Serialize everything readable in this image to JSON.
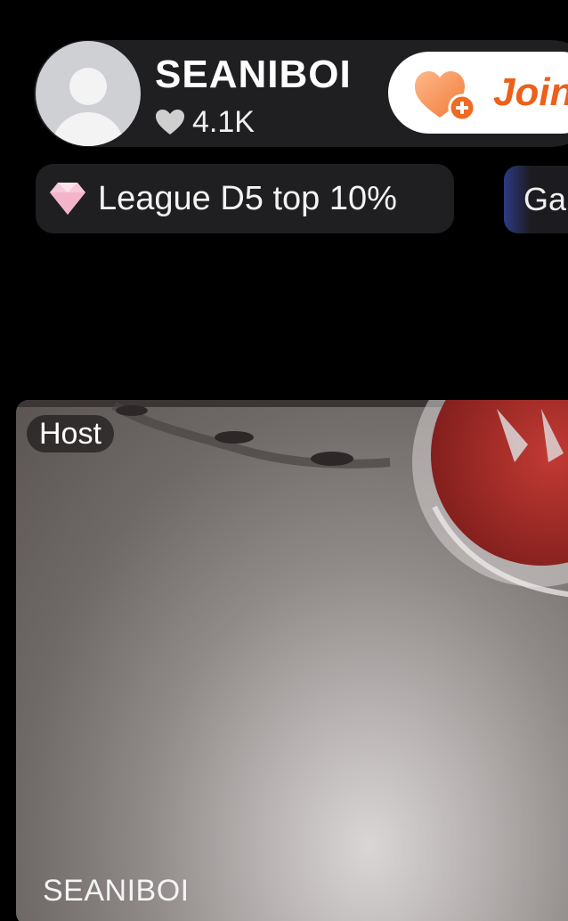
{
  "profile": {
    "username": "SEANIBOI",
    "likes": "4.1K",
    "avatar_icon": "default-avatar-icon"
  },
  "actions": {
    "join_label": "Join",
    "join_icon": "heart-plus-icon",
    "accent_color": "#ee5f1a"
  },
  "badges": {
    "league_text": "League D5 top 10%",
    "league_icon": "diamond-icon",
    "gallery_text": "Gal"
  },
  "video": {
    "host_tag": "Host",
    "host_name": "SEANIBOI"
  }
}
